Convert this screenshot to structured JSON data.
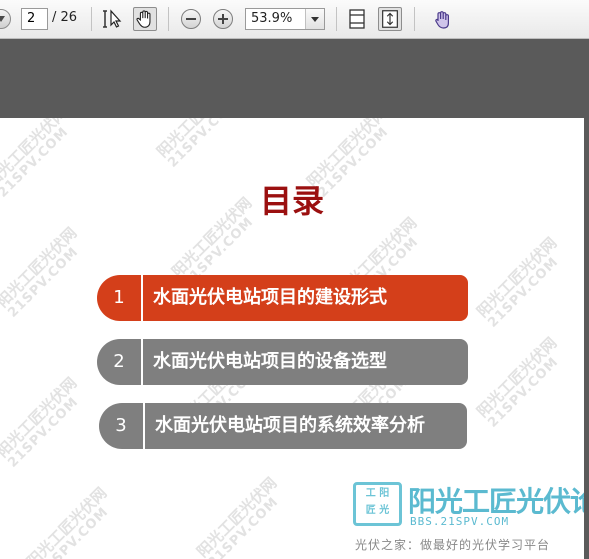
{
  "toolbar": {
    "page_current": "2",
    "page_total": "/ 26",
    "zoom": "53.9%"
  },
  "page": {
    "title": "目录",
    "watermark_line1": "阳光工匠光伏网",
    "watermark_line2": "21SPV.COM",
    "toc": [
      {
        "num": "1",
        "label": "水面光伏电站项目的建设形式",
        "style": "active",
        "color": "#d43f1a"
      },
      {
        "num": "2",
        "label": "水面光伏电站项目的设备选型",
        "style": "inactive",
        "color": "#7f7f7f"
      },
      {
        "num": "3",
        "label": "水面光伏电站项目的系统效率分析",
        "style": "inactive",
        "color": "#7f7f7f"
      }
    ],
    "logo": {
      "box_line1": "工 阳",
      "box_line2": "匠 光",
      "name": "阳光工匠光伏论坛",
      "url": "BBS.21SPV.COM",
      "tagline": "光伏之家：做最好的光伏学习平台"
    }
  },
  "colors": {
    "title": "#9b1010",
    "accent": "#d43f1a",
    "inactive": "#7f7f7f",
    "logo": "#5bbad0"
  }
}
